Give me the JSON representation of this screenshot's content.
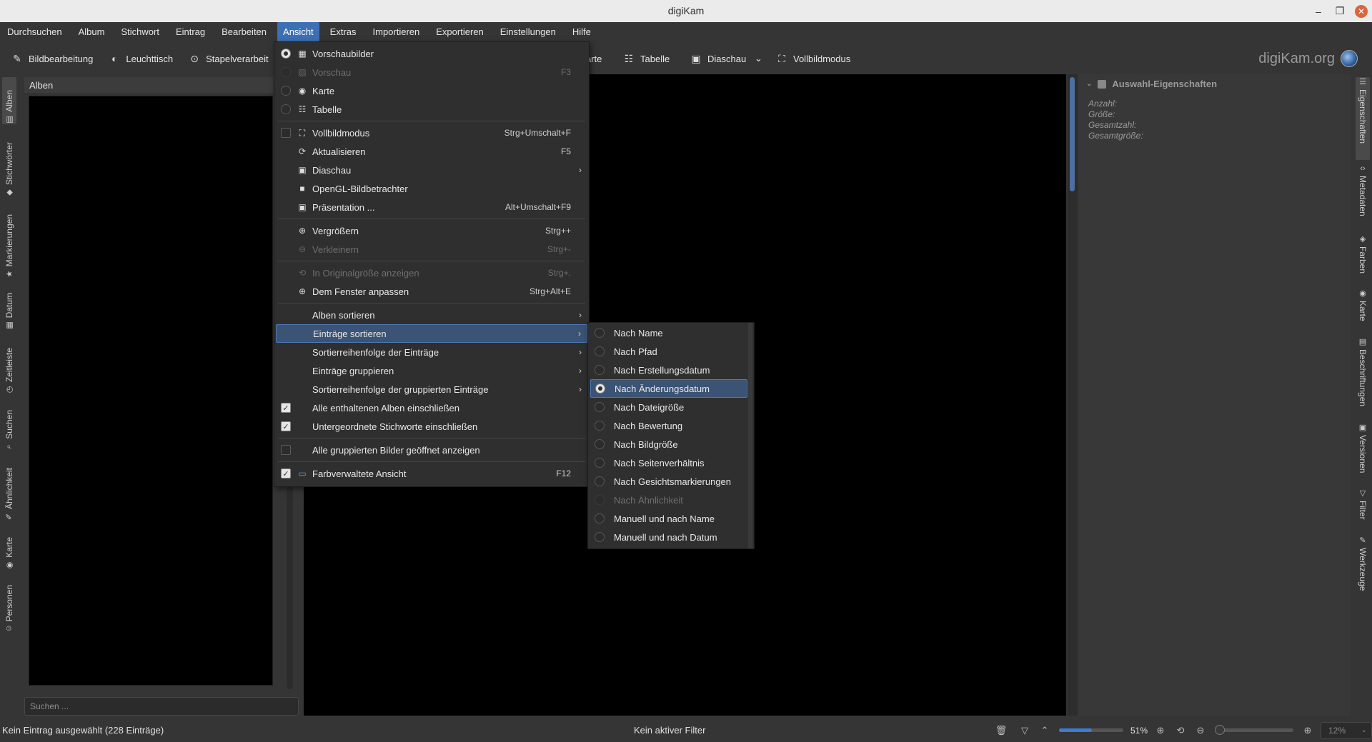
{
  "window": {
    "title": "digiKam"
  },
  "menubar": [
    "Durchsuchen",
    "Album",
    "Stichwort",
    "Eintrag",
    "Bearbeiten",
    "Ansicht",
    "Extras",
    "Importieren",
    "Exportieren",
    "Einstellungen",
    "Hilfe"
  ],
  "menubar_active": "Ansicht",
  "toolbar": {
    "bildbearbeitung": "Bildbearbeitung",
    "leuchttisch": "Leuchttisch",
    "stapel": "Stapelverarbeit",
    "karte": "arte",
    "tabelle": "Tabelle",
    "diaschau": "Diaschau",
    "vollbild": "Vollbildmodus"
  },
  "brand": "digiKam.org",
  "left_tabs": [
    "Alben",
    "Stichwörter",
    "Markierungen",
    "Datum",
    "Zeitleiste",
    "Suchen",
    "Ähnlichkeit",
    "Karte",
    "Personen"
  ],
  "right_tabs": [
    "Eigenschaften",
    "Metadaten",
    "Farben",
    "Karte",
    "Beschriftungen",
    "Versionen",
    "Filter",
    "Werkzeuge"
  ],
  "albums": {
    "header": "Alben",
    "search_placeholder": "Suchen ..."
  },
  "properties": {
    "header": "Auswahl-Eigenschaften",
    "fields": [
      "Anzahl:",
      "Größe:",
      "Gesamtzahl:",
      "Gesamtgröße:"
    ]
  },
  "view_menu": {
    "vorschaubilder": "Vorschaubilder",
    "vorschau": "Vorschau",
    "vorschau_sc": "F3",
    "karte": "Karte",
    "tabelle": "Tabelle",
    "vollbild": "Vollbildmodus",
    "vollbild_sc": "Strg+Umschalt+F",
    "aktualisieren": "Aktualisieren",
    "aktualisieren_sc": "F5",
    "diaschau": "Diaschau",
    "opengl": "OpenGL-Bildbetrachter",
    "praesentation": "Präsentation ...",
    "praesentation_sc": "Alt+Umschalt+F9",
    "vergroessern": "Vergrößern",
    "vergroessern_sc": "Strg++",
    "verkleinern": "Verkleinern",
    "verkleinern_sc": "Strg+-",
    "original": "In Originalgröße anzeigen",
    "original_sc": "Strg+.",
    "anpassen": "Dem Fenster anpassen",
    "anpassen_sc": "Strg+Alt+E",
    "alben_sort": "Alben sortieren",
    "eintraege_sort": "Einträge sortieren",
    "sort_order": "Sortierreihenfolge der Einträge",
    "gruppieren": "Einträge gruppieren",
    "group_order": "Sortierreihenfolge der gruppierten Einträge",
    "alle_alben": "Alle enthaltenen Alben einschließen",
    "unter_stichworte": "Untergeordnete Stichworte einschließen",
    "gruppierte_offen": "Alle gruppierten Bilder geöffnet anzeigen",
    "farbverwaltet": "Farbverwaltete Ansicht",
    "farbverwaltet_sc": "F12"
  },
  "sort_submenu": {
    "name": "Nach Name",
    "pfad": "Nach Pfad",
    "erstellung": "Nach Erstellungsdatum",
    "aenderung": "Nach Änderungsdatum",
    "dateigroesse": "Nach Dateigröße",
    "bewertung": "Nach Bewertung",
    "bildgroesse": "Nach Bildgröße",
    "seitenverhaeltnis": "Nach Seitenverhältnis",
    "gesicht": "Nach Gesichtsmarkierungen",
    "aehnlichkeit": "Nach Ähnlichkeit",
    "manuell_name": "Manuell und nach Name",
    "manuell_datum": "Manuell und nach Datum",
    "selected": "Nach Änderungsdatum"
  },
  "status": {
    "left": "Kein Eintrag ausgewählt (228 Einträge)",
    "middle": "Kein aktiver Filter",
    "thumb_zoom": "51%",
    "thumb_zoom_fraction": 0.51,
    "preview_zoom": "12%"
  },
  "colors": {
    "accent": "#3d6fb4",
    "highlight": "#3b5374",
    "background": "#353535"
  }
}
